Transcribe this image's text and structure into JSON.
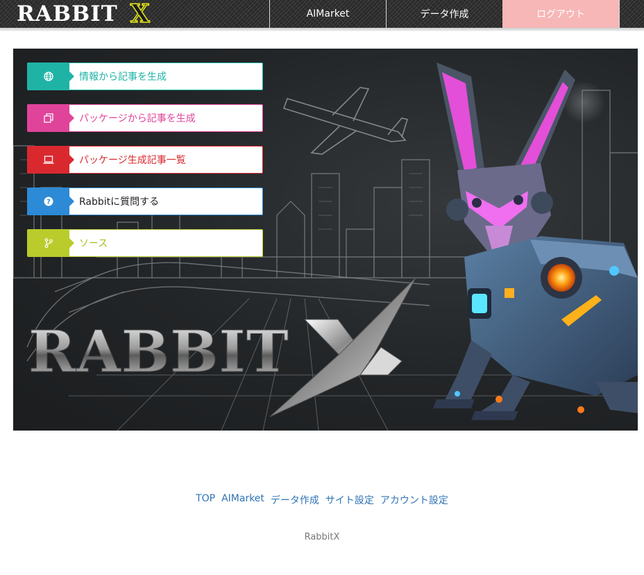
{
  "header": {
    "logo_text": "RABBIT",
    "logo_mark": "X",
    "nav": [
      {
        "label": "AIMarket"
      },
      {
        "label": "データ作成"
      },
      {
        "label": "ログアウト"
      }
    ]
  },
  "hero": {
    "banner_title": "RABBIT",
    "banner_mark": "X"
  },
  "menu": {
    "items": [
      {
        "label": "情報から記事を生成",
        "icon": "globe-icon",
        "color": "#1fb3a6"
      },
      {
        "label": "パッケージから記事を生成",
        "icon": "windows-icon",
        "color": "#e0449a"
      },
      {
        "label": "パッケージ生成記事一覧",
        "icon": "laptop-icon",
        "color": "#d9292f"
      },
      {
        "label": "Rabbitに質問する",
        "icon": "question-icon",
        "color": "#2d8ad6",
        "text_color": "#222222"
      },
      {
        "label": "ソース",
        "icon": "branch-icon",
        "color": "#b9cc2b"
      }
    ]
  },
  "footer": {
    "links": [
      {
        "label": "TOP"
      },
      {
        "label": "AIMarket"
      },
      {
        "label": "データ作成"
      },
      {
        "label": "サイト設定"
      },
      {
        "label": "アカウント設定"
      }
    ],
    "copyright": "RabbitX"
  },
  "colors": {
    "logo_accent": "#e8ec1c",
    "logout_bg": "#f7b7b7",
    "link": "#2f74b5"
  }
}
